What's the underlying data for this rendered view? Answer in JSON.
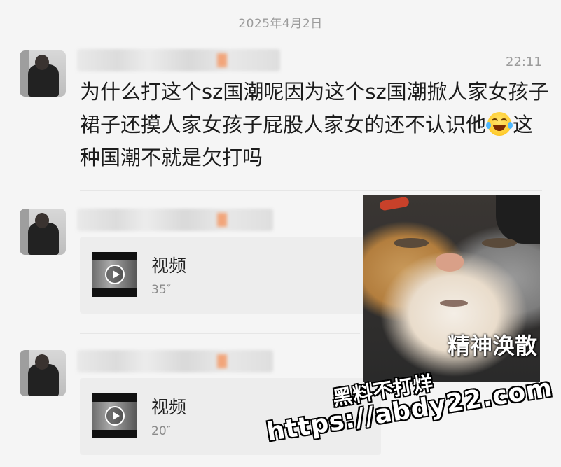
{
  "date_separator": "2025年4月2日",
  "comment1": {
    "time": "22:11",
    "text_part1": "为什么打这个sz国潮呢因为这个sz国潮掀人家女孩子裙子还摸人家女孩子屁股人家女的还不认识他",
    "emoji": "laughing-with-tears",
    "text_part2": "这种国潮不就是欠打吗"
  },
  "comment2": {
    "video": {
      "title": "视频",
      "duration": "35″"
    }
  },
  "comment3": {
    "video": {
      "title": "视频",
      "duration": "20″"
    }
  },
  "sticker": {
    "caption": "精神涣散"
  },
  "watermark": {
    "line1": "黑料不打烊",
    "line2": "https://abdy22.com"
  },
  "colors": {
    "background": "#f5f5f5",
    "muted_text": "#9b9b9b",
    "card": "#ededed"
  }
}
